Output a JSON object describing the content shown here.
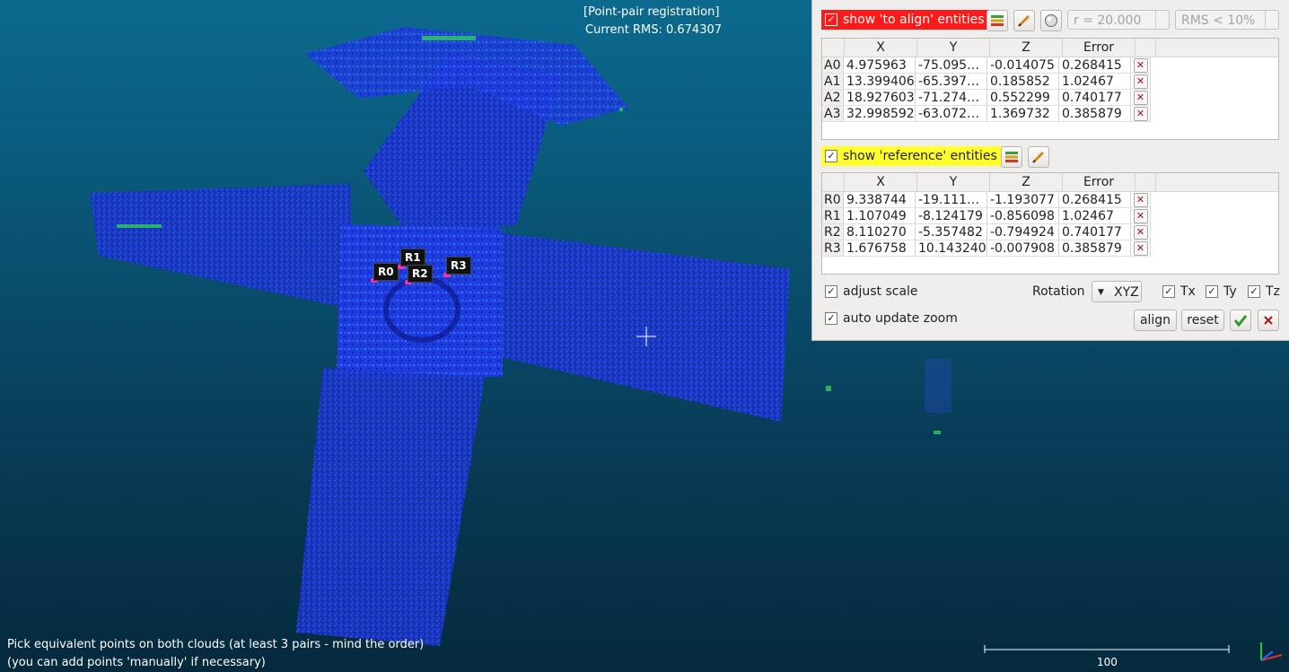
{
  "viewport": {
    "mode_title": "[Point-pair registration]",
    "rms_text": "Current RMS: 0.674307",
    "markers": [
      "R0",
      "R1",
      "R2",
      "R3"
    ],
    "hint_line1": "Pick equivalent points on both clouds (at least 3 pairs - mind the order)",
    "hint_line2": "(you can add points 'manually' if necessary)",
    "scale_value": "100"
  },
  "panel": {
    "to_align": {
      "label": "show 'to align' entities",
      "radius": "r = 20.000",
      "rms_filter": "RMS < 10%",
      "headers": [
        "X",
        "Y",
        "Z",
        "Error"
      ],
      "rows": [
        {
          "id": "A0",
          "x": "4.975963",
          "y": "-75.095…",
          "z": "-0.014075",
          "error": "0.268415"
        },
        {
          "id": "A1",
          "x": "13.399406",
          "y": "-65.397…",
          "z": "0.185852",
          "error": "1.02467"
        },
        {
          "id": "A2",
          "x": "18.927603",
          "y": "-71.274…",
          "z": "0.552299",
          "error": "0.740177"
        },
        {
          "id": "A3",
          "x": "32.998592",
          "y": "-63.072…",
          "z": "1.369732",
          "error": "0.385879"
        }
      ]
    },
    "reference": {
      "label": "show 'reference' entities",
      "headers": [
        "X",
        "Y",
        "Z",
        "Error"
      ],
      "rows": [
        {
          "id": "R0",
          "x": "9.338744",
          "y": "-19.111…",
          "z": "-1.193077",
          "error": "0.268415"
        },
        {
          "id": "R1",
          "x": "1.107049",
          "y": "-8.124179",
          "z": "-0.856098",
          "error": "1.02467"
        },
        {
          "id": "R2",
          "x": "8.110270",
          "y": "-5.357482",
          "z": "-0.794924",
          "error": "0.740177"
        },
        {
          "id": "R3",
          "x": "1.676758",
          "y": "10.143240",
          "z": "-0.007908",
          "error": "0.385879"
        }
      ]
    },
    "options": {
      "adjust_scale": "adjust scale",
      "auto_update_zoom": "auto update zoom",
      "rotation_label": "Rotation",
      "rotation_value": "XYZ",
      "tx": "Tx",
      "ty": "Ty",
      "tz": "Tz",
      "align": "align",
      "reset": "reset"
    },
    "colors": {
      "to_align_highlight": "#ff1a1a",
      "reference_highlight": "#ffff2b"
    }
  }
}
